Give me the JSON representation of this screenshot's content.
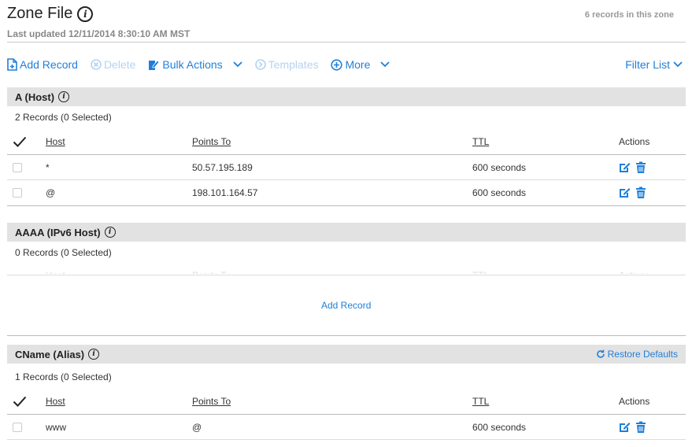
{
  "header": {
    "title": "Zone File",
    "last_updated": "Last updated 12/11/2014 8:30:10 AM MST",
    "record_count": "6 records in this zone"
  },
  "toolbar": {
    "add_record": "Add Record",
    "delete": "Delete",
    "bulk_actions": "Bulk Actions",
    "templates": "Templates",
    "more": "More",
    "filter_list": "Filter List"
  },
  "columns": {
    "host": "Host",
    "points_to": "Points To",
    "ttl": "TTL",
    "actions": "Actions"
  },
  "sections": {
    "a": {
      "title": "A (Host)",
      "summary": "2 Records (0 Selected)",
      "rows": [
        {
          "host": "*",
          "points_to": "50.57.195.189",
          "ttl": "600 seconds"
        },
        {
          "host": "@",
          "points_to": "198.101.164.57",
          "ttl": "600 seconds"
        }
      ]
    },
    "aaaa": {
      "title": "AAAA (IPv6 Host)",
      "summary": "0 Records (0 Selected)",
      "add_record": "Add Record"
    },
    "cname": {
      "title": "CName (Alias)",
      "summary": "1 Records (0 Selected)",
      "restore_defaults": "Restore Defaults",
      "rows": [
        {
          "host": "www",
          "points_to": "@",
          "ttl": "600 seconds"
        }
      ]
    }
  },
  "colors": {
    "accent": "#1f7fd9",
    "section_bg": "#e2e2e2"
  }
}
